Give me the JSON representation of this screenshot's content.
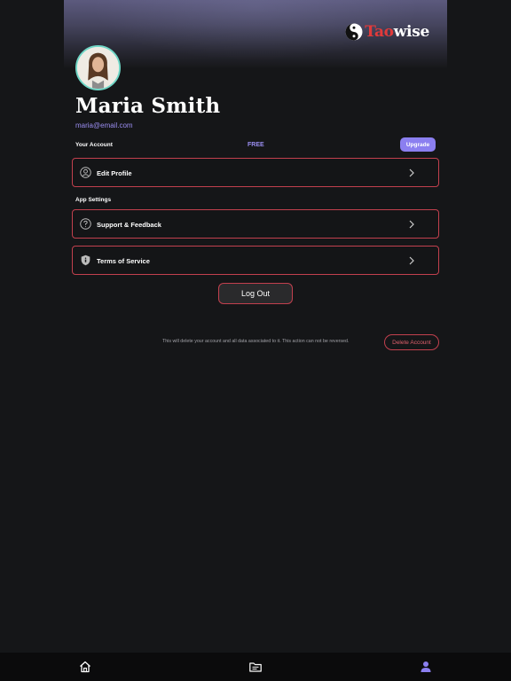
{
  "header": {
    "logo_text_part1": "Tao",
    "logo_text_part2": "wise"
  },
  "profile": {
    "name": "Maria Smith",
    "email": "maria@email.com"
  },
  "account": {
    "label": "Your Account",
    "plan": "FREE",
    "upgrade_label": "Upgrade"
  },
  "menu": {
    "edit_profile": {
      "label": "Edit Profile",
      "icon": "user-circle-icon"
    },
    "section_label": "App Settings",
    "support": {
      "label": "Support & Feedback",
      "icon": "question-circle-icon"
    },
    "terms": {
      "label": "Terms of Service",
      "icon": "shield-icon"
    }
  },
  "actions": {
    "logout_label": "Log Out",
    "delete_warning": "This will delete  your account and all data associated to it. This action can not be reversed.",
    "delete_label": "Delete Account"
  },
  "bottom_nav": {
    "items": [
      {
        "icon": "home-icon",
        "active": false
      },
      {
        "icon": "folder-icon",
        "active": false
      },
      {
        "icon": "person-icon",
        "active": true
      }
    ]
  },
  "colors": {
    "background": "#151618",
    "accent": "#8b7ff0",
    "border_red": "#c2404e",
    "avatar_ring": "#6fd6c6"
  }
}
